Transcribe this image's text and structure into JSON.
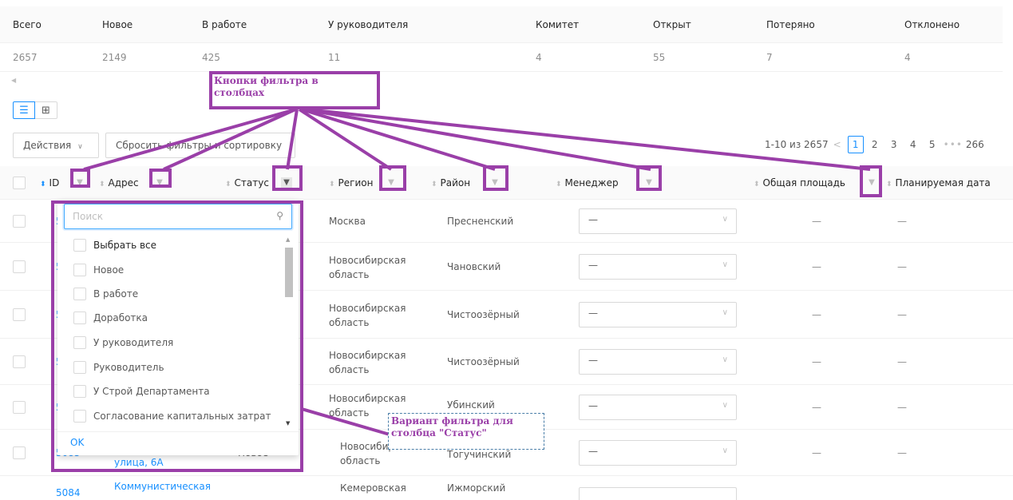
{
  "stats": {
    "headers": [
      "Всего",
      "Новое",
      "В работе",
      "У руководителя",
      "Комитет",
      "Открыт",
      "Потеряно",
      "Отклонено"
    ],
    "values": [
      "2657",
      "2149",
      "425",
      "11",
      "4",
      "55",
      "7",
      "4"
    ]
  },
  "view_switch": {
    "list_icon": "list-icon",
    "grid_icon": "grid-icon"
  },
  "toolbar": {
    "actions_label": "Действия",
    "reset_label": "Сбросить фильтры и сортировку"
  },
  "pagination": {
    "range": "1-10 из 2657",
    "pages": [
      "1",
      "2",
      "3",
      "4",
      "5"
    ],
    "current": "1",
    "last": "266",
    "dots": "•••"
  },
  "table": {
    "columns": {
      "id": "ID",
      "address": "Адрес",
      "status": "Статус",
      "region": "Регион",
      "district": "Район",
      "manager": "Менеджер",
      "area": "Общая площадь",
      "planned_date": "Планируемая дата"
    },
    "rows": [
      {
        "id": "5",
        "region": "Москва",
        "district": "Пресненский",
        "manager": "—",
        "area": "—",
        "date": "—"
      },
      {
        "id": "5",
        "region": "Новосибирская область",
        "district": "Чановский",
        "manager": "—",
        "area": "—",
        "date": "—"
      },
      {
        "id": "5",
        "region": "Новосибирская область",
        "district": "Чистоозёрный",
        "manager": "—",
        "area": "—",
        "date": "—"
      },
      {
        "id": "5",
        "region": "Новосибирская область",
        "district": "Чистоозёрный",
        "manager": "—",
        "area": "—",
        "date": "—"
      },
      {
        "id": "5",
        "region": "Новосибирская область",
        "district": "Убинский",
        "manager": "—",
        "area": "—",
        "date": "—"
      },
      {
        "id": "5085",
        "address": "улица, 6А",
        "status": "Новое",
        "region": "Новосибирская область",
        "district": "Тогучинский",
        "manager": "—",
        "area": "—",
        "date": "—"
      },
      {
        "id": "5084",
        "address": "Коммунистическая",
        "region": "Кемеровская",
        "district": "Ижморский"
      }
    ]
  },
  "filter_dropdown": {
    "search_placeholder": "Поиск",
    "options": [
      "Выбрать все",
      "Новое",
      "В работе",
      "Доработка",
      "У руководителя",
      "Руководитель",
      "У Строй Департамента",
      "Согласование капитальных затрат"
    ],
    "ok_label": "OK"
  },
  "annotations": {
    "filter_buttons_line1": "Кнопки фильтра в",
    "filter_buttons_line2": "столбцах",
    "status_filter_line1": "Вариант фильтра для",
    "status_filter_line2": "столбца \"Статус\""
  },
  "colors": {
    "accent": "#1890ff",
    "annotation": "#9a3fa8"
  }
}
